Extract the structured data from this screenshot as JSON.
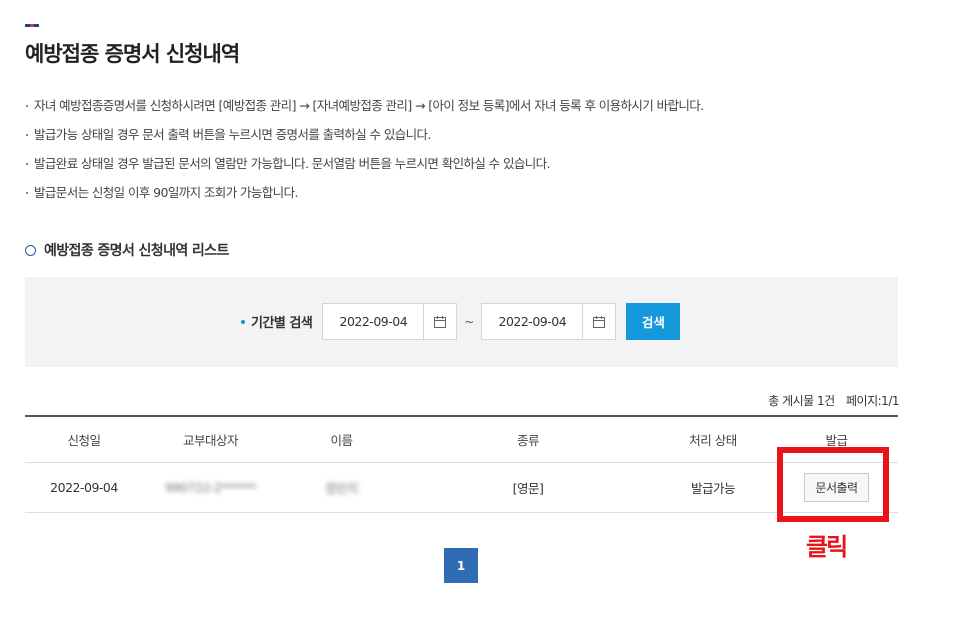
{
  "flag_colors": [
    "#1c3f8e",
    "#d9363e",
    "#1c3f8e"
  ],
  "page": {
    "title": "예방접종 증명서 신청내역",
    "notices": [
      "자녀 예방접종증명서를 신청하시려면 [예방접종 관리] → [자녀예방접종 관리] → [아이 정보 등록]에서 자녀 등록 후 이용하시기 바랍니다.",
      "발급가능 상태일 경우 문서 출력 버튼을 누르시면 증명서를 출력하실 수 있습니다.",
      "발급완료 상태일 경우 발급된 문서의 열람만 가능합니다. 문서열람 버튼을 누르시면 확인하실 수 있습니다.",
      "발급문서는 신청일 이후 90일까지 조회가 가능합니다."
    ]
  },
  "section": {
    "title": "예방접종 증명서 신청내역 리스트"
  },
  "search": {
    "label": "기간별 검색",
    "start_date": "2022-09-04",
    "separator": "~",
    "end_date": "2022-09-04",
    "button_label": "검색"
  },
  "paging_info": {
    "total": "총 게시물 1건",
    "page": "페이지:1/1"
  },
  "table": {
    "headers": [
      "신청일",
      "교부대상자",
      "이름",
      "종류",
      "처리 상태",
      "발급"
    ],
    "rows": [
      {
        "date": "2022-09-04",
        "recipient": "990722-2******",
        "name": "정민지",
        "type": "[영문]",
        "status": "발급가능",
        "action_label": "문서출력"
      }
    ]
  },
  "annotation": {
    "label": "클릭",
    "color": "#e8141a"
  },
  "pagination": {
    "current": "1"
  },
  "colors": {
    "accent": "#1597db",
    "pager": "#2f6cb3",
    "annotation": "#e8141a"
  }
}
